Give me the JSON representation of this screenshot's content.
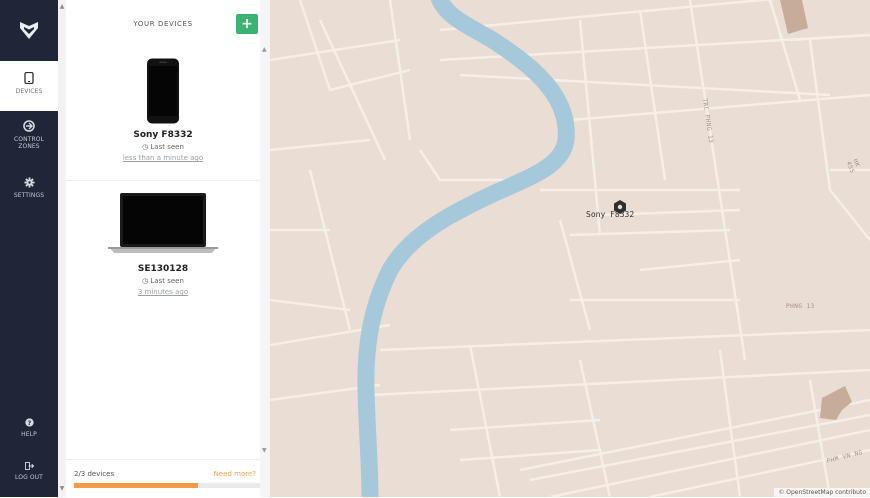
{
  "nav": {
    "items": [
      {
        "label": "DEVICES",
        "icon": "tablet-icon",
        "active": true
      },
      {
        "label": "CONTROL ZONES",
        "icon": "control-zones-icon",
        "active": false
      },
      {
        "label": "SETTINGS",
        "icon": "gear-icon",
        "active": false
      }
    ],
    "bottom": [
      {
        "label": "HELP",
        "icon": "help-icon"
      },
      {
        "label": "LOG OUT",
        "icon": "logout-icon"
      }
    ]
  },
  "panel": {
    "title": "YOUR DEVICES",
    "add_label": "+",
    "devices": [
      {
        "name": "Sony F8332",
        "last_seen_label": "Last seen",
        "last_seen_time": "less than a minute ago",
        "type": "phone"
      },
      {
        "name": "SE130128",
        "last_seen_label": "Last seen",
        "last_seen_time": "3 minutes ago",
        "type": "laptop"
      }
    ],
    "footer": {
      "count": "2/3 devices",
      "need_more": "Need more?",
      "usage_fraction": 0.667
    }
  },
  "map": {
    "pin": {
      "label": "Sony F8332",
      "icon": "pin-hexagon-icon"
    },
    "labels": [
      "TRC PHNG 13",
      "HK 455",
      "PHNG 13",
      "PHM VN NG"
    ],
    "attribution": "© OpenStreetMap contributo",
    "colors": {
      "land": "#eaddd3",
      "water": "#a6c8db",
      "road": "#f6efe8",
      "building": "#c7ad99"
    }
  }
}
